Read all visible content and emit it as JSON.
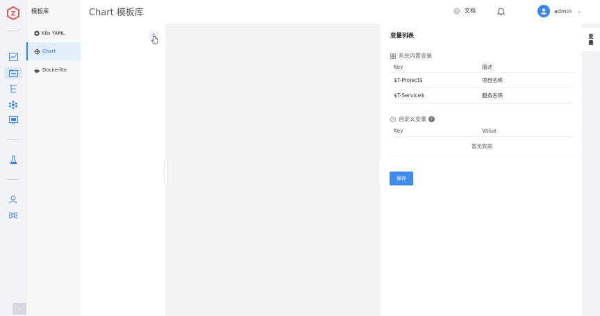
{
  "header": {
    "page_title": "Chart 模板库",
    "docs_label": "文档",
    "username": "admin"
  },
  "subnav": {
    "title": "模板库",
    "items": [
      {
        "label": "K8s YAML",
        "active": false
      },
      {
        "label": "Chart",
        "active": true
      },
      {
        "label": "Dockerfile",
        "active": false
      }
    ]
  },
  "filepane": {
    "add_symbol": "+"
  },
  "variables": {
    "title": "变量列表",
    "system_section": "系统内置变量",
    "system_columns": [
      "Key",
      "描述"
    ],
    "system_rows": [
      {
        "key": "$T-Project$",
        "desc": "项目名称"
      },
      {
        "key": "$T-Service$",
        "desc": "服务名称"
      }
    ],
    "custom_section": "自定义变量",
    "custom_columns": [
      "Key",
      "Value"
    ],
    "empty_text": "暂无数据",
    "save_label": "保存"
  },
  "sidetab": {
    "label": "变量"
  },
  "colors": {
    "primary": "#3f8cf0",
    "active_bg": "#e3eefb"
  }
}
